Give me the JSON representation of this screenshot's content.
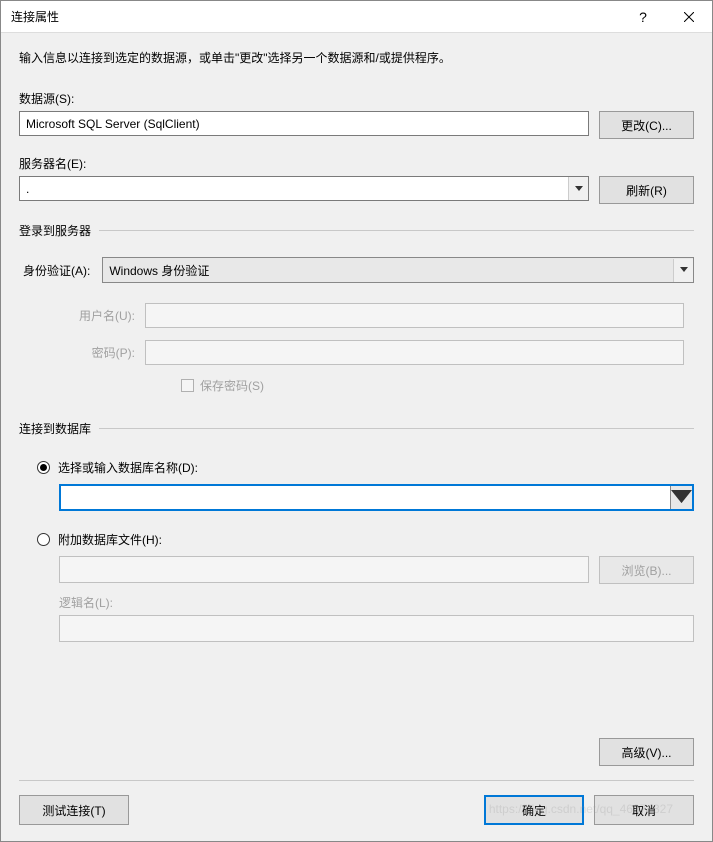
{
  "titlebar": {
    "title": "连接属性",
    "help": "?",
    "close": "✕"
  },
  "intro": "输入信息以连接到选定的数据源，或单击\"更改\"选择另一个数据源和/或提供程序。",
  "datasource": {
    "label": "数据源(S):",
    "value": "Microsoft SQL Server (SqlClient)",
    "change_btn": "更改(C)..."
  },
  "server": {
    "label": "服务器名(E):",
    "value": ".",
    "refresh_btn": "刷新(R)"
  },
  "login": {
    "legend": "登录到服务器",
    "auth_label": "身份验证(A):",
    "auth_value": "Windows 身份验证",
    "user_label": "用户名(U):",
    "pwd_label": "密码(P):",
    "save_pwd": "保存密码(S)"
  },
  "database": {
    "legend": "连接到数据库",
    "radio_select": "选择或输入数据库名称(D):",
    "radio_attach": "附加数据库文件(H):",
    "browse_btn": "浏览(B)...",
    "logical_label": "逻辑名(L):"
  },
  "advanced_btn": "高级(V)...",
  "bottom": {
    "test": "测试连接(T)",
    "ok": "确定",
    "cancel": "取消"
  },
  "watermark": "https://blog.csdn.net/qq_46374327"
}
